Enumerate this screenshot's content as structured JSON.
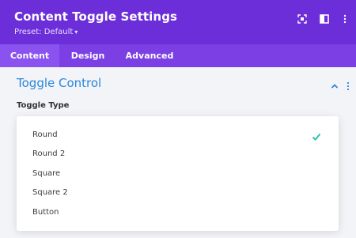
{
  "header": {
    "title": "Content Toggle Settings",
    "preset_label": "Preset: Default",
    "icons": [
      "fullscreen-icon",
      "sidebar-layout-icon",
      "more-vertical-icon"
    ]
  },
  "tabs": [
    {
      "label": "Content",
      "active": true
    },
    {
      "label": "Design",
      "active": false
    },
    {
      "label": "Advanced",
      "active": false
    }
  ],
  "section": {
    "title": "Toggle Control",
    "expanded": true
  },
  "field": {
    "label": "Toggle Type",
    "options": [
      {
        "label": "Round",
        "selected": true
      },
      {
        "label": "Round 2",
        "selected": false
      },
      {
        "label": "Square",
        "selected": false
      },
      {
        "label": "Square 2",
        "selected": false
      },
      {
        "label": "Button",
        "selected": false
      }
    ]
  },
  "colors": {
    "header_bg": "#6c2ed8",
    "tabs_bg": "#7b3fe4",
    "active_tab_bg": "#8a52ef",
    "section_title": "#2b87da",
    "check": "#29c4a9"
  }
}
